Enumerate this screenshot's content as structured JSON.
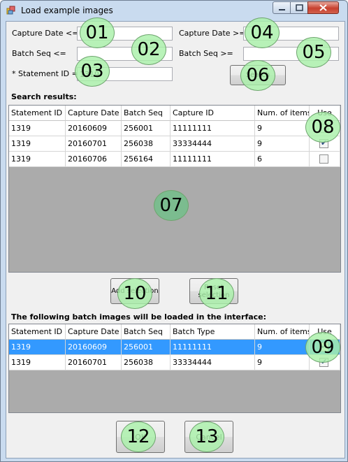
{
  "window": {
    "title": "Load example images"
  },
  "search_form": {
    "capture_date_from_label": "Capture Date <=",
    "capture_date_to_label": "Capture Date >=",
    "batch_seq_from_label": "Batch Seq <=",
    "batch_seq_to_label": "Batch Seq >=",
    "statement_id_label": "* Statement ID =",
    "statement_id_value": "1319",
    "search_button": "Search"
  },
  "search_results": {
    "heading": "Search results:",
    "columns": [
      "Statement ID",
      "Capture Date",
      "Batch Seq",
      "Capture ID",
      "Num. of items",
      "Use"
    ],
    "rows": [
      [
        "1319",
        "20160609",
        "256001",
        "11111111",
        "9"
      ],
      [
        "1319",
        "20160701",
        "256038",
        "33334444",
        "9"
      ],
      [
        "1319",
        "20160706",
        "256164",
        "11111111",
        "6"
      ]
    ],
    "use_checked": [
      false,
      true,
      false
    ]
  },
  "actions": {
    "add_selection": "Add selection",
    "reset_selection": "Reset selection"
  },
  "loaded_batches": {
    "heading": "The following batch images will be loaded in the interface:",
    "columns": [
      "Statement ID",
      "Capture Date",
      "Batch Seq",
      "Batch Type",
      "Num. of items",
      "Use"
    ],
    "rows": [
      [
        "1319",
        "20160609",
        "256001",
        "11111111",
        "9"
      ],
      [
        "1319",
        "20160701",
        "256038",
        "33334444",
        "9"
      ]
    ],
    "use_checked": [
      true,
      true
    ]
  },
  "footer": {
    "ok_button": "OK",
    "cancel_button": "Cancel"
  },
  "callouts": [
    "01",
    "02",
    "03",
    "04",
    "05",
    "06",
    "07",
    "08",
    "09",
    "10",
    "11",
    "12",
    "13"
  ]
}
